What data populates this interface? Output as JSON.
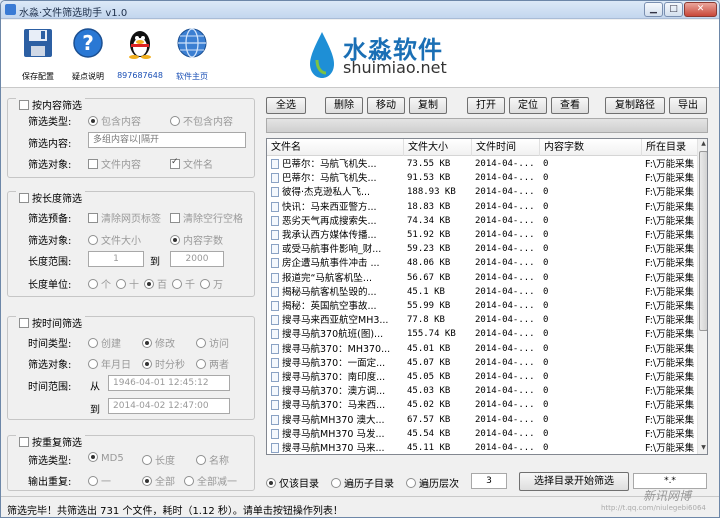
{
  "window": {
    "title": "水淼·文件筛选助手 v1.0"
  },
  "toolbar": {
    "items": [
      {
        "label": "保存配置",
        "icon": "floppy-disk-icon"
      },
      {
        "label": "疑点说明",
        "icon": "help-icon"
      },
      {
        "label": "897687648",
        "icon": "qq-penguin-icon"
      },
      {
        "label": "软件主页",
        "icon": "globe-icon"
      }
    ],
    "logo_cn": "水淼软件",
    "logo_en": "shuimiao.net"
  },
  "content_filter": {
    "title": "按内容筛选",
    "type_label": "筛选类型:",
    "include": "包含内容",
    "exclude": "不包含内容",
    "content_label": "筛选内容:",
    "content_placeholder": "多组内容以|隔开",
    "target_label": "筛选对象:",
    "file_content": "文件内容",
    "file_name": "文件名"
  },
  "length_filter": {
    "title": "按长度筛选",
    "pre_label": "筛选预备:",
    "clear_tags": "清除网页标签",
    "clear_spaces": "清除空行空格",
    "target_label": "筛选对象:",
    "file_size": "文件大小",
    "content_chars": "内容字数",
    "range_label": "长度范围:",
    "range_from": "1",
    "range_to_label": "到",
    "range_to": "2000",
    "unit_label": "长度单位:",
    "units": [
      "个",
      "十",
      "百",
      "千",
      "万"
    ]
  },
  "time_filter": {
    "title": "按时间筛选",
    "type_label": "时间类型:",
    "types": [
      "创建",
      "修改",
      "访问"
    ],
    "target_label": "筛选对象:",
    "targets": [
      "年月日",
      "时分秒",
      "两者"
    ],
    "range_label": "时间范围:",
    "from_label": "从",
    "from_value": "1946-04-01 12:45:12",
    "to_label": "到",
    "to_value": "2014-04-02 12:47:00"
  },
  "dup_filter": {
    "title": "按重复筛选",
    "type_label": "筛选类型:",
    "types": [
      "MD5",
      "长度",
      "名称"
    ],
    "output_label": "输出重复:",
    "outputs": [
      "一",
      "全部",
      "全部减一"
    ]
  },
  "actions": {
    "select_all": "全选",
    "delete": "删除",
    "move": "移动",
    "copy": "复制",
    "open": "打开",
    "locate": "定位",
    "view": "查看",
    "copy_path": "复制路径",
    "export": "导出"
  },
  "list": {
    "columns": [
      "文件名",
      "文件大小",
      "文件时间",
      "内容字数",
      "所在目录"
    ],
    "rows": [
      {
        "name": "巴蒂尔：马航飞机失...",
        "size": "73.55 KB",
        "time": "2014-04-...",
        "chars": "0",
        "dir": "F:\\万能采集"
      },
      {
        "name": "巴蒂尔：马航飞机失...",
        "size": "91.53 KB",
        "time": "2014-04-...",
        "chars": "0",
        "dir": "F:\\万能采集"
      },
      {
        "name": "彼得·杰克逊私人飞...",
        "size": "188.93 KB",
        "time": "2014-04-...",
        "chars": "0",
        "dir": "F:\\万能采集"
      },
      {
        "name": "快讯：马来西亚警方...",
        "size": "18.83 KB",
        "time": "2014-04-...",
        "chars": "0",
        "dir": "F:\\万能采集"
      },
      {
        "name": "恶劣天气再成搜索失...",
        "size": "74.34 KB",
        "time": "2014-04-...",
        "chars": "0",
        "dir": "F:\\万能采集"
      },
      {
        "name": "我承认西方媒体传播...",
        "size": "51.92 KB",
        "time": "2014-04-...",
        "chars": "0",
        "dir": "F:\\万能采集"
      },
      {
        "name": "或受马航事件影响_财...",
        "size": "59.23 KB",
        "time": "2014-04-...",
        "chars": "0",
        "dir": "F:\\万能采集"
      },
      {
        "name": "房企遭马航事件冲击 ...",
        "size": "48.06 KB",
        "time": "2014-04-...",
        "chars": "0",
        "dir": "F:\\万能采集"
      },
      {
        "name": "报道完“马航客机坠...",
        "size": "56.67 KB",
        "time": "2014-04-...",
        "chars": "0",
        "dir": "F:\\万能采集"
      },
      {
        "name": "揭秘马航客机坠毁的...",
        "size": "45.1 KB",
        "time": "2014-04-...",
        "chars": "0",
        "dir": "F:\\万能采集"
      },
      {
        "name": "揭秘：英国航空事故...",
        "size": "55.99 KB",
        "time": "2014-04-...",
        "chars": "0",
        "dir": "F:\\万能采集"
      },
      {
        "name": "搜寻马来西亚航空MH3...",
        "size": "77.8 KB",
        "time": "2014-04-...",
        "chars": "0",
        "dir": "F:\\万能采集"
      },
      {
        "name": "搜寻马航370航班(图)...",
        "size": "155.74 KB",
        "time": "2014-04-...",
        "chars": "0",
        "dir": "F:\\万能采集"
      },
      {
        "name": "搜寻马航370：MH370...",
        "size": "45.01 KB",
        "time": "2014-04-...",
        "chars": "0",
        "dir": "F:\\万能采集"
      },
      {
        "name": "搜寻马航370：一面定...",
        "size": "45.07 KB",
        "time": "2014-04-...",
        "chars": "0",
        "dir": "F:\\万能采集"
      },
      {
        "name": "搜寻马航370：南印度...",
        "size": "45.05 KB",
        "time": "2014-04-...",
        "chars": "0",
        "dir": "F:\\万能采集"
      },
      {
        "name": "搜寻马航370：澳方调...",
        "size": "45.03 KB",
        "time": "2014-04-...",
        "chars": "0",
        "dir": "F:\\万能采集"
      },
      {
        "name": "搜寻马航370：马来西...",
        "size": "45.02 KB",
        "time": "2014-04-...",
        "chars": "0",
        "dir": "F:\\万能采集"
      },
      {
        "name": "搜寻马航MH370 澳大...",
        "size": "67.57 KB",
        "time": "2014-04-...",
        "chars": "0",
        "dir": "F:\\万能采集"
      },
      {
        "name": "搜寻马航MH370 马发...",
        "size": "45.54 KB",
        "time": "2014-04-...",
        "chars": "0",
        "dir": "F:\\万能采集"
      },
      {
        "name": "搜寻马航MH370 马来...",
        "size": "45.11 KB",
        "time": "2014-04-...",
        "chars": "0",
        "dir": "F:\\万能采集"
      }
    ]
  },
  "bottom": {
    "opt_this_dir": "仅该目录",
    "opt_subdirs": "遍历子目录",
    "opt_levels": "遍历层次",
    "levels_value": "3",
    "start_button": "选择目录开始筛选",
    "pattern_value": "*.*"
  },
  "status": {
    "text": "筛选完毕！共筛选出 731 个文件，耗时（1.12 秒）。请单击按钮操作列表！"
  },
  "watermark": {
    "text": "新讯网博",
    "url": "http://t.qq.com/niulegebi6064"
  }
}
